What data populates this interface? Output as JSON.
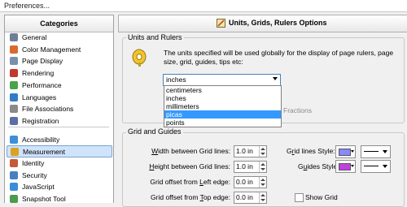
{
  "window": {
    "title": "Preferences..."
  },
  "sidebar": {
    "header": "Categories",
    "items": [
      {
        "label": "General",
        "icon": "general-icon",
        "color": "#6f7f96"
      },
      {
        "label": "Color Management",
        "icon": "color-management-icon",
        "color": "#d96a2c"
      },
      {
        "label": "Page Display",
        "icon": "page-display-icon",
        "color": "#7b8fa8"
      },
      {
        "label": "Rendering",
        "icon": "rendering-icon",
        "color": "#c0392b"
      },
      {
        "label": "Performance",
        "icon": "performance-icon",
        "color": "#4aa34a"
      },
      {
        "label": "Languages",
        "icon": "languages-icon",
        "color": "#2f7dc7"
      },
      {
        "label": "File Associations",
        "icon": "file-associations-icon",
        "color": "#8a8a8a"
      },
      {
        "label": "Registration",
        "icon": "registration-icon",
        "color": "#5a6fa3"
      },
      {
        "label": "Accessibility",
        "icon": "accessibility-icon",
        "color": "#3d8fd6"
      },
      {
        "label": "Measurement",
        "icon": "measurement-icon",
        "color": "#d9a21f",
        "selected": true
      },
      {
        "label": "Identity",
        "icon": "identity-icon",
        "color": "#c45a3a"
      },
      {
        "label": "Security",
        "icon": "security-icon",
        "color": "#4a7fc0"
      },
      {
        "label": "JavaScript",
        "icon": "javascript-icon",
        "color": "#3a8dd8"
      },
      {
        "label": "Snapshot Tool",
        "icon": "snapshot-tool-icon",
        "color": "#4e9a4e"
      }
    ]
  },
  "panel": {
    "title": "Units, Grids, Rulers Options",
    "units_group": {
      "title": "Units and Rulers",
      "description": "The units specified will be used globally for the display of page rulers, page size, grid, guides, tips etc:",
      "selected": "inches",
      "options": [
        "centimeters",
        "inches",
        "millimeters",
        "picas",
        "points"
      ],
      "highlighted": "picas",
      "fractions_label": "Fractions"
    },
    "grid_group": {
      "title": "Grid and Guides",
      "fields": [
        {
          "label_pre": "",
          "label_ul": "W",
          "label_post": "idth between Grid lines:",
          "value": "1.0 in"
        },
        {
          "label_pre": "",
          "label_ul": "H",
          "label_post": "eight between Grid lines:",
          "value": "1.0 in"
        },
        {
          "label_pre": "Grid offset from ",
          "label_ul": "L",
          "label_post": "eft edge:",
          "value": "0.0 in"
        },
        {
          "label_pre": "Grid offset from ",
          "label_ul": "T",
          "label_post": "op edge:",
          "value": "0.0 in"
        }
      ],
      "grid_lines_style": {
        "label_pre": "G",
        "label_ul": "r",
        "label_post": "id lines Style:",
        "color": "#8888ff"
      },
      "guides_style": {
        "label_pre": "G",
        "label_ul": "u",
        "label_post": "ides Style:",
        "color": "#c040e0"
      },
      "show_grid": {
        "label": "Show Grid",
        "checked": false
      }
    }
  }
}
